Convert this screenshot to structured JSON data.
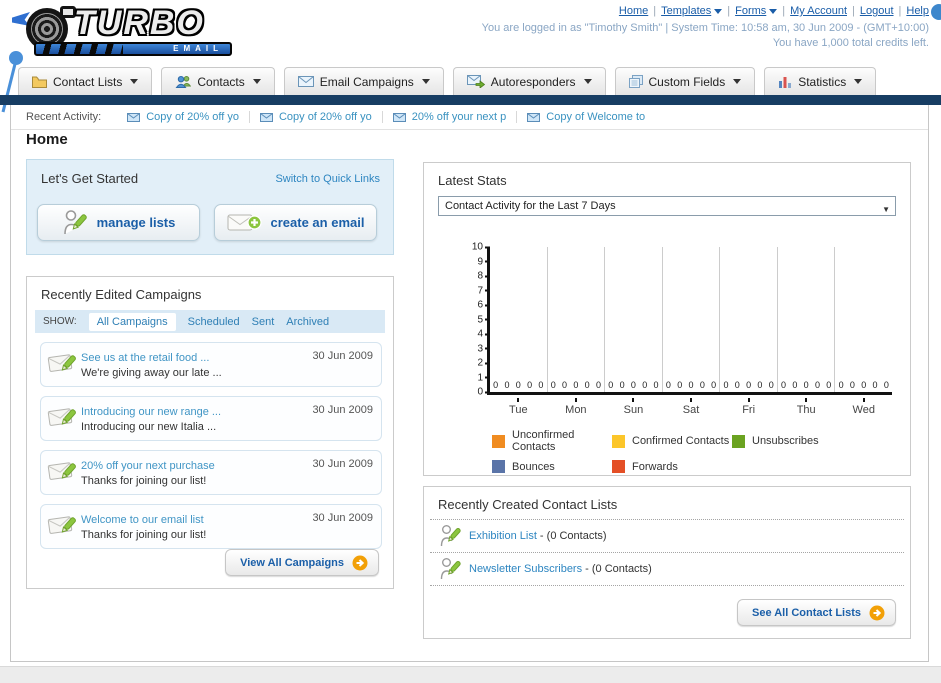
{
  "header": {
    "logo_line1": "TURBO",
    "logo_line2": "EMAIL",
    "separator": "|",
    "nav_links": [
      {
        "label": "Home"
      },
      {
        "label": "Templates"
      },
      {
        "label": "Forms"
      },
      {
        "label": "My Account"
      },
      {
        "label": "Logout"
      },
      {
        "label": "Help"
      }
    ],
    "login_line1": "You are logged in as \"Timothy Smith\" | System Time: 10:58 am, 30 Jun 2009 - (GMT+10:00)",
    "login_line2": "You have 1,000 total credits left."
  },
  "tabs": [
    {
      "label": "Contact Lists"
    },
    {
      "label": "Contacts"
    },
    {
      "label": "Email Campaigns"
    },
    {
      "label": "Autoresponders"
    },
    {
      "label": "Custom Fields"
    },
    {
      "label": "Statistics"
    }
  ],
  "recent_activity": {
    "label": "Recent Activity:",
    "items": [
      {
        "label": "Copy of 20% off yo"
      },
      {
        "label": "Copy of 20% off yo"
      },
      {
        "label": "20% off your next p"
      },
      {
        "label": "Copy of Welcome to"
      }
    ]
  },
  "page_title": "Home",
  "get_started": {
    "title": "Let's Get Started",
    "switch_link": "Switch to Quick Links",
    "buttons": [
      {
        "label": "manage lists"
      },
      {
        "label": "create an email"
      }
    ]
  },
  "campaigns": {
    "title": "Recently Edited Campaigns",
    "show_label": "SHOW:",
    "filters": [
      {
        "label": "All Campaigns",
        "selected": true
      },
      {
        "label": "Scheduled",
        "selected": false
      },
      {
        "label": "Sent",
        "selected": false
      },
      {
        "label": "Archived",
        "selected": false
      }
    ],
    "items": [
      {
        "title": "See us at the retail food ...",
        "subtitle": "We're giving away our late ...",
        "date": "30 Jun 2009"
      },
      {
        "title": "Introducing our new range ...",
        "subtitle": "Introducing our new Italia ...",
        "date": "30 Jun 2009"
      },
      {
        "title": "20% off your next purchase",
        "subtitle": "Thanks for joining our list!",
        "date": "30 Jun 2009"
      },
      {
        "title": "Welcome to our email list",
        "subtitle": "Thanks for joining our list!",
        "date": "30 Jun 2009"
      }
    ],
    "view_all_label": "View All Campaigns"
  },
  "stats": {
    "title": "Latest Stats",
    "dropdown_value": "Contact Activity for the Last 7 Days"
  },
  "chart_data": {
    "type": "bar",
    "title": "Contact Activity for the Last 7 Days",
    "categories": [
      "Tue",
      "Mon",
      "Sun",
      "Sat",
      "Fri",
      "Thu",
      "Wed"
    ],
    "series": [
      {
        "name": "Unconfirmed Contacts",
        "color": "#f08c21",
        "values": [
          0,
          0,
          0,
          0,
          0,
          0,
          0
        ]
      },
      {
        "name": "Confirmed Contacts",
        "color": "#fcc62a",
        "values": [
          0,
          0,
          0,
          0,
          0,
          0,
          0
        ]
      },
      {
        "name": "Unsubscribes",
        "color": "#6ba321",
        "values": [
          0,
          0,
          0,
          0,
          0,
          0,
          0
        ]
      },
      {
        "name": "Bounces",
        "color": "#5a74a8",
        "values": [
          0,
          0,
          0,
          0,
          0,
          0,
          0
        ]
      },
      {
        "name": "Forwards",
        "color": "#e44f26",
        "values": [
          0,
          0,
          0,
          0,
          0,
          0,
          0
        ]
      }
    ],
    "ylim": [
      0,
      10
    ],
    "y_ticks": [
      0,
      1,
      2,
      3,
      4,
      5,
      6,
      7,
      8,
      9,
      10
    ],
    "value_labels_shown": true,
    "grid": "vertical",
    "legend_position": "bottom"
  },
  "contact_lists": {
    "title": "Recently Created Contact Lists",
    "items": [
      {
        "name": "Exhibition List",
        "suffix": " - (0 Contacts)"
      },
      {
        "name": "Newsletter Subscribers",
        "suffix": " - (0 Contacts)"
      }
    ],
    "see_all_label": "See All Contact Lists"
  }
}
